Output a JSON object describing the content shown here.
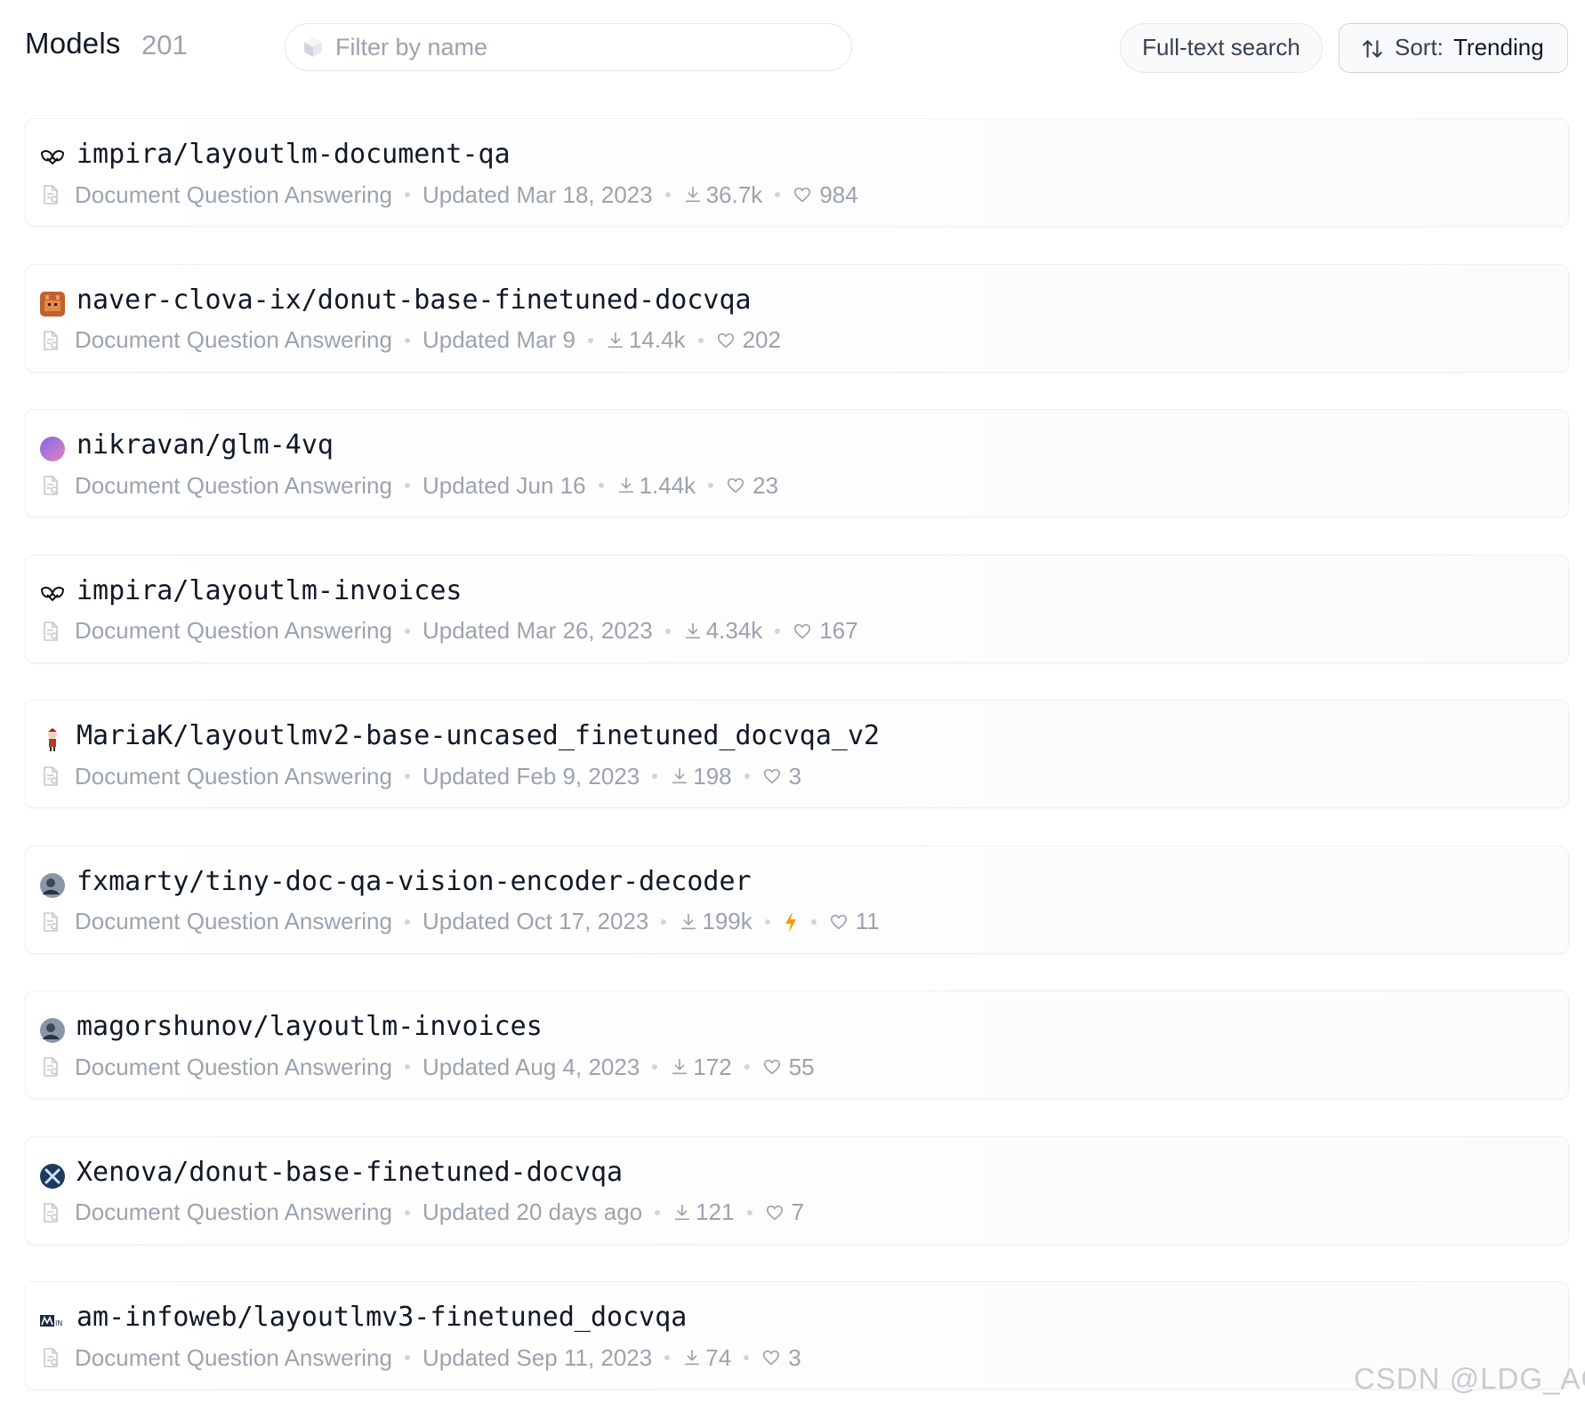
{
  "header": {
    "title": "Models",
    "count": "201",
    "filter_placeholder": "Filter by name",
    "full_text_search_label": "Full-text search",
    "sort_label": "Sort:",
    "sort_value": "Trending"
  },
  "models": [
    {
      "name": "impira/layoutlm-document-qa",
      "task": "Document Question Answering",
      "updated": "Updated Mar 18, 2023",
      "downloads": "36.7k",
      "likes": "984",
      "avatar": "impira-logo-icon",
      "inference": false
    },
    {
      "name": "naver-clova-ix/donut-base-finetuned-docvqa",
      "task": "Document Question Answering",
      "updated": "Updated Mar 9",
      "downloads": "14.4k",
      "likes": "202",
      "avatar": "naver-clova-avatar-icon",
      "inference": false
    },
    {
      "name": "nikravan/glm-4vq",
      "task": "Document Question Answering",
      "updated": "Updated Jun 16",
      "downloads": "1.44k",
      "likes": "23",
      "avatar": "gradient-avatar-icon",
      "inference": false
    },
    {
      "name": "impira/layoutlm-invoices",
      "task": "Document Question Answering",
      "updated": "Updated Mar 26, 2023",
      "downloads": "4.34k",
      "likes": "167",
      "avatar": "impira-logo-icon",
      "inference": false
    },
    {
      "name": "MariaK/layoutlmv2-base-uncased_finetuned_docvqa_v2",
      "task": "Document Question Answering",
      "updated": "Updated Feb 9, 2023",
      "downloads": "198",
      "likes": "3",
      "avatar": "character-avatar-icon",
      "inference": false
    },
    {
      "name": "fxmarty/tiny-doc-qa-vision-encoder-decoder",
      "task": "Document Question Answering",
      "updated": "Updated Oct 17, 2023",
      "downloads": "199k",
      "likes": "11",
      "avatar": "photo-avatar-icon",
      "inference": true
    },
    {
      "name": "magorshunov/layoutlm-invoices",
      "task": "Document Question Answering",
      "updated": "Updated Aug 4, 2023",
      "downloads": "172",
      "likes": "55",
      "avatar": "photo-avatar-icon",
      "inference": false
    },
    {
      "name": "Xenova/donut-base-finetuned-docvqa",
      "task": "Document Question Answering",
      "updated": "Updated 20 days ago",
      "downloads": "121",
      "likes": "7",
      "avatar": "xenova-logo-icon",
      "inference": false
    },
    {
      "name": "am-infoweb/layoutlmv3-finetuned_docvqa",
      "task": "Document Question Answering",
      "updated": "Updated Sep 11, 2023",
      "downloads": "74",
      "likes": "3",
      "avatar": "am-infoweb-logo-icon",
      "inference": false
    }
  ],
  "watermark": "CSDN @LDG_AGI",
  "colors": {
    "text_primary": "#111827",
    "text_muted": "#9ca3af",
    "border": "#eef0f2",
    "inference_bolt": "#f59e0b"
  }
}
